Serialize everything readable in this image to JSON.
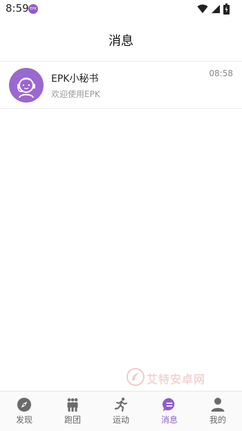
{
  "status_bar": {
    "time": "8:59",
    "app_badge": "EPK"
  },
  "header": {
    "title": "消息"
  },
  "conversations": [
    {
      "name": "EPK小秘书",
      "preview": "欢迎使用EPK",
      "time": "08:58",
      "avatar_color": "#9b67d0"
    }
  ],
  "watermark": {
    "text": "艾特安卓网"
  },
  "tabs": [
    {
      "label": "发现",
      "icon": "compass-icon",
      "active": false
    },
    {
      "label": "跑团",
      "icon": "group-icon",
      "active": false
    },
    {
      "label": "运动",
      "icon": "running-icon",
      "active": false
    },
    {
      "label": "消息",
      "icon": "message-icon",
      "active": true
    },
    {
      "label": "我的",
      "icon": "person-icon",
      "active": false
    }
  ],
  "colors": {
    "accent": "#8e5cc9",
    "inactive_icon": "#6b6b6b"
  }
}
